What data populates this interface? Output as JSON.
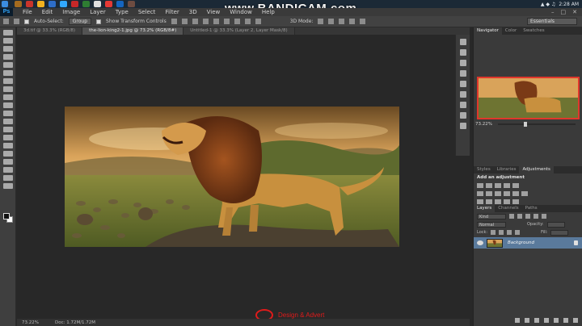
{
  "watermark": {
    "prefix": "www.",
    "brand": "BANDICAM",
    "suffix": ".com"
  },
  "taskbar": {
    "clock": "2:28 AM"
  },
  "menubar": {
    "logo": "Ps",
    "items": [
      "File",
      "Edit",
      "Image",
      "Layer",
      "Type",
      "Select",
      "Filter",
      "3D",
      "View",
      "Window",
      "Help"
    ]
  },
  "options_bar": {
    "auto_select_label": "Auto-Select:",
    "auto_select_value": "Group",
    "transform_label": "Show Transform Controls",
    "mode_3d_label": "3D Mode:",
    "workspace": "Essentials"
  },
  "doc_tabs": [
    {
      "label": "3d.tif @ 33.3% (RGB/8)",
      "active": false
    },
    {
      "label": "the-lion-king2-1.jpg @ 73.2% (RGB/8#)",
      "active": true
    },
    {
      "label": "Untitled-1 @ 33.3% (Layer 2, Layer Mask/8)",
      "active": false
    }
  ],
  "status_bar": {
    "zoom": "73.22%",
    "doc_size": "Doc: 1.72M/1.72M"
  },
  "advert": {
    "text": "Design & Advert"
  },
  "navigator": {
    "tabs": [
      "Navigator",
      "Color",
      "Swatches"
    ],
    "zoom": "73.22%"
  },
  "adjustments": {
    "tabs": [
      "Styles",
      "Libraries",
      "Adjustments"
    ],
    "title": "Add an adjustment"
  },
  "layers": {
    "tabs": [
      "Layers",
      "Channels",
      "Paths"
    ],
    "kind_label": "Kind",
    "blend_mode": "Normal",
    "opacity_label": "Opacity:",
    "lock_label": "Lock:",
    "fill_label": "Fill:",
    "items": [
      {
        "name": "Background",
        "selected": true
      }
    ]
  },
  "colors": {
    "taskbar": "#1b2936",
    "menubar": "#3a3a3a",
    "canvas_bg": "#282828",
    "panel_bg": "#3a3a3a",
    "layer_selected": "#5a7a9c",
    "highlight_red": "#e0372c",
    "advert_red": "#e01b1b"
  }
}
